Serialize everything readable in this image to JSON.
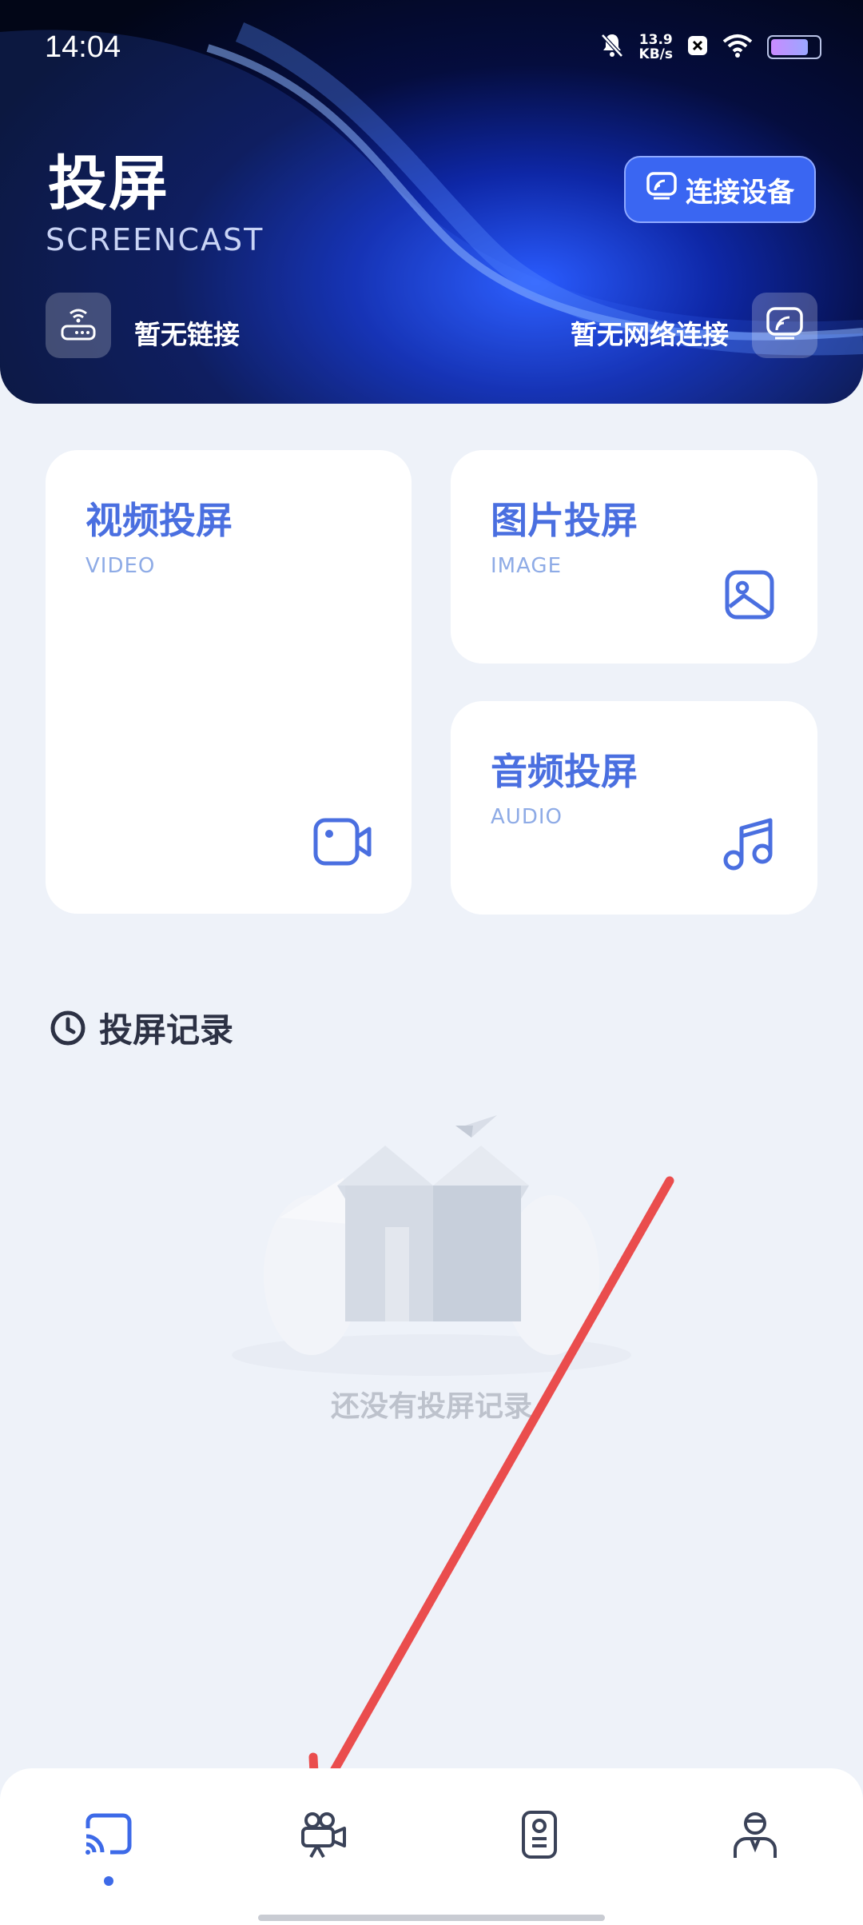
{
  "status_bar": {
    "time": "14:04",
    "net_speed_value": "13.9",
    "net_speed_unit": "KB/s",
    "icons": [
      "bell-off-icon",
      "x-app-icon",
      "wifi-icon",
      "battery-icon"
    ]
  },
  "header": {
    "title": "投屏",
    "subtitle": "SCREENCAST",
    "connect_button": "连接设备",
    "link_status": "暂无链接",
    "network_status": "暂无网络连接",
    "colors": {
      "accent": "#3a66f2",
      "dark": "#020617"
    }
  },
  "cards": {
    "video": {
      "title": "视频投屏",
      "subtitle": "VIDEO",
      "icon": "video-camera-icon"
    },
    "image": {
      "title": "图片投屏",
      "subtitle": "IMAGE",
      "icon": "image-icon"
    },
    "audio": {
      "title": "音频投屏",
      "subtitle": "AUDIO",
      "icon": "music-note-icon"
    }
  },
  "records": {
    "title": "投屏记录",
    "empty_text": "还没有投屏记录"
  },
  "tabbar": {
    "active_index": 0,
    "tabs": [
      {
        "icon": "cast-icon"
      },
      {
        "icon": "movie-camera-icon"
      },
      {
        "icon": "remote-control-icon"
      },
      {
        "icon": "profile-icon"
      }
    ]
  }
}
